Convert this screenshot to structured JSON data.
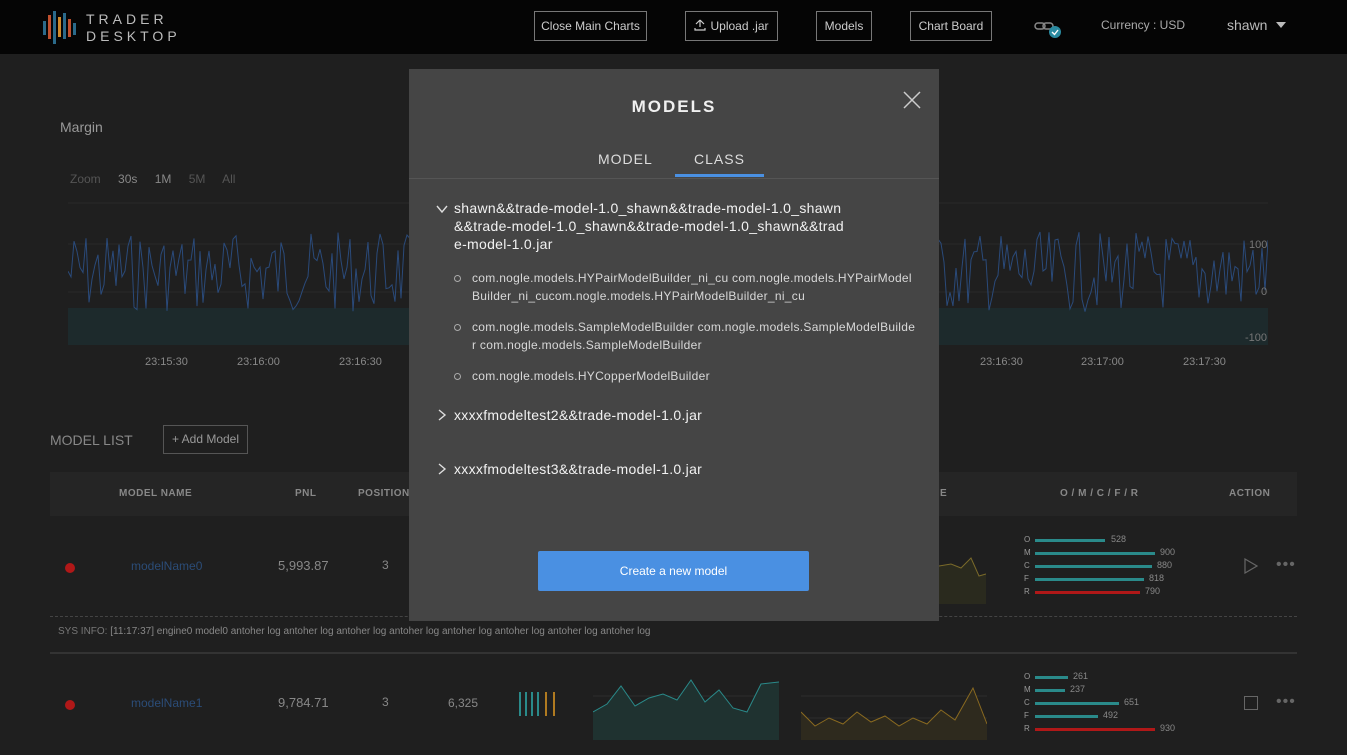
{
  "app": {
    "logo_line1": "TRADER",
    "logo_line2": "DESKTOP"
  },
  "topbar": {
    "close_main_charts": "Close Main Charts",
    "upload_jar": "Upload .jar",
    "models": "Models",
    "chart_board": "Chart Board",
    "currency": "Currency : USD",
    "user": "shawn"
  },
  "margin_chart": {
    "title": "Margin",
    "zoom_label": "Zoom",
    "zoom_options": [
      "30s",
      "1M",
      "5M",
      "All"
    ],
    "y_ticks": [
      "100",
      "0",
      "-100"
    ],
    "x_ticks": [
      "23:15:30",
      "23:16:00",
      "23:16:30",
      "23:16:30",
      "23:17:00",
      "23:17:30"
    ]
  },
  "model_list": {
    "title": "MODEL LIST",
    "add_model": "+ Add Model",
    "headers": {
      "model_name": "MODEL NAME",
      "pnl": "PNL",
      "position": "POSITION",
      "e": "E",
      "omcfr": "O / M / C / F / R",
      "action": "ACTION"
    },
    "rows": [
      {
        "name": "modelName0",
        "pnl": "5,993.87",
        "position": "3",
        "omcfr_labels": [
          "O",
          "M",
          "C",
          "F",
          "R"
        ],
        "omcfr_values": [
          "528",
          "900",
          "880",
          "818",
          "790"
        ]
      },
      {
        "name": "modelName1",
        "pnl": "9,784.71",
        "position": "3",
        "extra": "6,325",
        "omcfr_labels": [
          "O",
          "M",
          "C",
          "F",
          "R"
        ],
        "omcfr_values": [
          "261",
          "237",
          "651",
          "492",
          "930"
        ]
      }
    ],
    "sys_info_label": "SYS INFO:",
    "sys_info_text": "[11:17:37] engine0 model0 antoher log antoher log antoher log antoher log antoher log antoher log antoher log antoher log"
  },
  "modal": {
    "title": "MODELS",
    "tabs": [
      "MODEL",
      "CLASS"
    ],
    "active_tab": "CLASS",
    "jars": [
      {
        "name": "shawn&&trade-model-1.0_shawn&&trade-model-1.0_shawn&&trade-model-1.0_shawn&&trade-model-1.0_shawn&&trade-model-1.0.jar",
        "line1": "shawn&&trade-model-1.0_shawn&&trade-model-1.0_shawn",
        "line2": "&&trade-model-1.0_shawn&&trade-model-1.0_shawn&&trad",
        "line3": "e-model-1.0.jar",
        "expanded": true,
        "classes": [
          "com.nogle.models.HYPairModelBuilder_ni_cu com.nogle.models.HYPairModelBuilder_ni_cucom.nogle.models.HYPairModelBuilder_ni_cu",
          "com.nogle.models.SampleModelBuilder com.nogle.models.SampleModelBuilder com.nogle.models.SampleModelBuilder",
          "com.nogle.models.HYCopperModelBuilder"
        ]
      },
      {
        "name": "xxxxfmodeltest2&&trade-model-1.0.jar",
        "expanded": false
      },
      {
        "name": "xxxxfmodeltest3&&trade-model-1.0.jar",
        "expanded": false
      }
    ],
    "create_button": "Create a new model"
  },
  "colors": {
    "accent": "#4a90e2",
    "status_red": "#b01818",
    "bar_teal": "#2a8a8a",
    "bar_red": "#b01818"
  }
}
